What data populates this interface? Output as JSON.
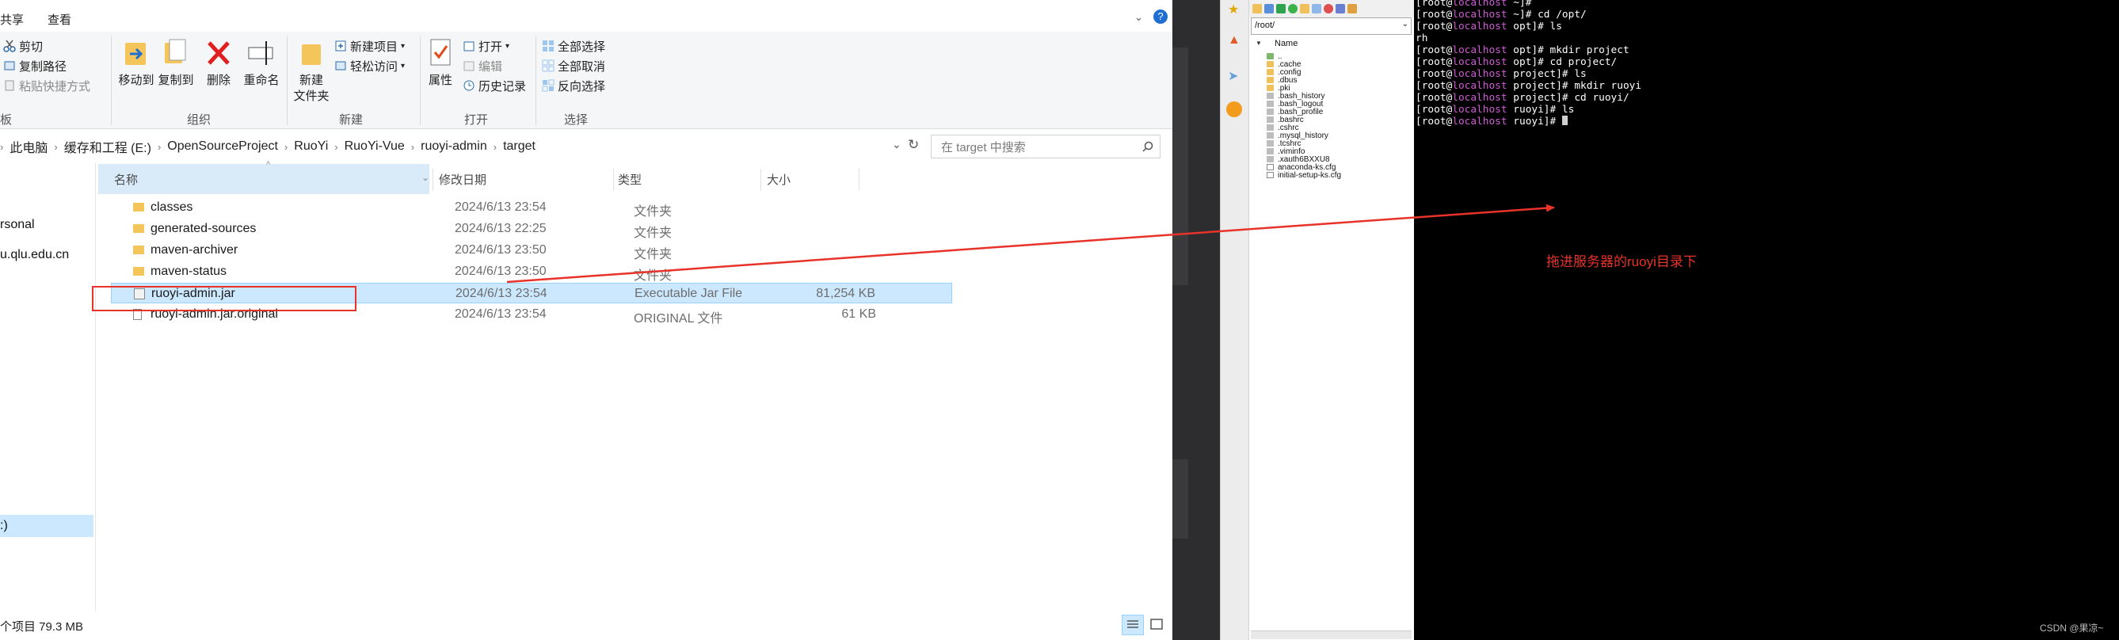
{
  "ribbon": {
    "tabs": [
      "共享",
      "查看"
    ],
    "clipboard": {
      "cut": "剪切",
      "copy_path": "复制路径",
      "paste_shortcut": "粘贴快捷方式",
      "group": "板"
    },
    "organize": {
      "move_to": "移动到",
      "copy_to": "复制到",
      "delete": "删除",
      "rename": "重命名",
      "group": "组织"
    },
    "new": {
      "new_folder_line1": "新建",
      "new_folder_line2": "文件夹",
      "new_item": "新建项目",
      "easy_access": "轻松访问",
      "group": "新建"
    },
    "open": {
      "properties": "属性",
      "open": "打开",
      "edit": "编辑",
      "history": "历史记录",
      "group": "打开"
    },
    "select": {
      "select_all": "全部选择",
      "select_none": "全部取消",
      "invert": "反向选择",
      "group": "选择"
    }
  },
  "address": {
    "crumbs": [
      "此电脑",
      "缓存和工程 (E:)",
      "OpenSourceProject",
      "RuoYi",
      "RuoYi-Vue",
      "ruoyi-admin",
      "target"
    ],
    "search_placeholder": "在 target 中搜索"
  },
  "nav": {
    "items": [
      "rsonal",
      "u.qlu.edu.cn",
      ":)"
    ]
  },
  "columns": {
    "name": "名称",
    "date": "修改日期",
    "type": "类型",
    "size": "大小"
  },
  "files": [
    {
      "name": "classes",
      "date": "2024/6/13 23:54",
      "type": "文件夹",
      "size": "",
      "kind": "folder"
    },
    {
      "name": "generated-sources",
      "date": "2024/6/13 22:25",
      "type": "文件夹",
      "size": "",
      "kind": "folder"
    },
    {
      "name": "maven-archiver",
      "date": "2024/6/13 23:50",
      "type": "文件夹",
      "size": "",
      "kind": "folder"
    },
    {
      "name": "maven-status",
      "date": "2024/6/13 23:50",
      "type": "文件夹",
      "size": "",
      "kind": "folder"
    },
    {
      "name": "ruoyi-admin.jar",
      "date": "2024/6/13 23:54",
      "type": "Executable Jar File",
      "size": "81,254 KB",
      "kind": "jar"
    },
    {
      "name": "ruoyi-admin.jar.original",
      "date": "2024/6/13 23:54",
      "type": "ORIGINAL 文件",
      "size": "61 KB",
      "kind": "file"
    }
  ],
  "status": {
    "text": "个项目  79.3 MB"
  },
  "sftp": {
    "path": "/root/",
    "header": "Name",
    "items": [
      {
        "name": "..",
        "kind": "up"
      },
      {
        "name": ".cache",
        "kind": "folder"
      },
      {
        "name": ".config",
        "kind": "folder"
      },
      {
        "name": ".dbus",
        "kind": "folder"
      },
      {
        "name": ".pki",
        "kind": "folder"
      },
      {
        "name": ".bash_history",
        "kind": "file"
      },
      {
        "name": ".bash_logout",
        "kind": "file"
      },
      {
        "name": ".bash_profile",
        "kind": "file"
      },
      {
        "name": ".bashrc",
        "kind": "file"
      },
      {
        "name": ".cshrc",
        "kind": "file"
      },
      {
        "name": ".mysql_history",
        "kind": "file"
      },
      {
        "name": ".tcshrc",
        "kind": "file"
      },
      {
        "name": ".viminfo",
        "kind": "file"
      },
      {
        "name": ".xauth6BXXU8",
        "kind": "file"
      },
      {
        "name": "anaconda-ks.cfg",
        "kind": "doc"
      },
      {
        "name": "initial-setup-ks.cfg",
        "kind": "doc"
      }
    ]
  },
  "terminal": {
    "lines": [
      {
        "user": "[root@",
        "host": "localhost",
        "rest": " ~]#",
        "plain": ""
      },
      {
        "user": "[root@",
        "host": "localhost",
        "rest": " ~]# cd /opt/",
        "plain": ""
      },
      {
        "user": "[root@",
        "host": "localhost",
        "rest": " opt]# ls",
        "plain": ""
      },
      {
        "user": "",
        "host": "",
        "rest": "",
        "plain": "rh"
      },
      {
        "user": "[root@",
        "host": "localhost",
        "rest": " opt]# mkdir project",
        "plain": ""
      },
      {
        "user": "[root@",
        "host": "localhost",
        "rest": " opt]# cd project/",
        "plain": ""
      },
      {
        "user": "[root@",
        "host": "localhost",
        "rest": " project]# ls",
        "plain": ""
      },
      {
        "user": "[root@",
        "host": "localhost",
        "rest": " project]# mkdir ruoyi",
        "plain": ""
      },
      {
        "user": "[root@",
        "host": "localhost",
        "rest": " project]# cd ruoyi/",
        "plain": ""
      },
      {
        "user": "[root@",
        "host": "localhost",
        "rest": " ruoyi]# ls",
        "plain": ""
      },
      {
        "user": "[root@",
        "host": "localhost",
        "rest": " ruoyi]# ",
        "plain": ""
      }
    ]
  },
  "annotation": {
    "text": "拖进服务器的ruoyi目录下",
    "color": "#e8322a"
  },
  "watermark": "CSDN @果凉~"
}
